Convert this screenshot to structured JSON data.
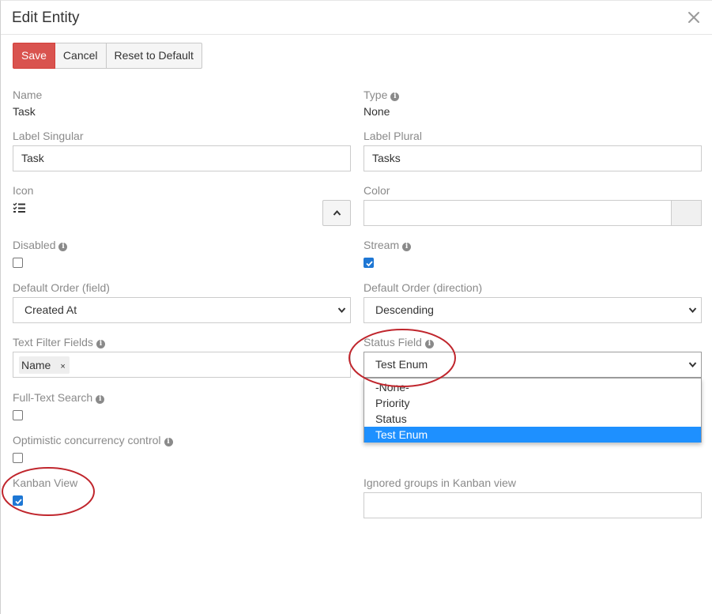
{
  "header": {
    "title": "Edit Entity",
    "close_icon": "close-icon"
  },
  "toolbar": {
    "save_label": "Save",
    "cancel_label": "Cancel",
    "reset_label": "Reset to Default"
  },
  "colors": {
    "save_bg": "#d9534f",
    "checkbox_checked": "#1e77d4",
    "selected_option": "#1e90ff",
    "annotation": "#c0262d"
  },
  "fields": {
    "name": {
      "label": "Name",
      "value": "Task"
    },
    "type": {
      "label": "Type",
      "value": "None"
    },
    "label_singular": {
      "label": "Label Singular",
      "value": "Task"
    },
    "label_plural": {
      "label": "Label Plural",
      "value": "Tasks"
    },
    "icon": {
      "label": "Icon",
      "icon_name": "tasks-checklist-icon"
    },
    "color": {
      "label": "Color",
      "value": ""
    },
    "disabled": {
      "label": "Disabled",
      "checked": false
    },
    "stream": {
      "label": "Stream",
      "checked": true
    },
    "default_order_field": {
      "label": "Default Order (field)",
      "value": "Created At"
    },
    "default_order_direction": {
      "label": "Default Order (direction)",
      "value": "Descending"
    },
    "text_filter_fields": {
      "label": "Text Filter Fields",
      "tags": [
        "Name"
      ],
      "tag_remove": "×"
    },
    "status_field": {
      "label": "Status Field",
      "value": "Test Enum",
      "options": [
        "-None-",
        "Priority",
        "Status",
        "Test Enum"
      ],
      "selected_index": 3
    },
    "full_text_search": {
      "label": "Full-Text Search",
      "checked": false
    },
    "optimistic_concurrency": {
      "label": "Optimistic concurrency control",
      "checked": false
    },
    "kanban_view": {
      "label": "Kanban View",
      "checked": true
    },
    "ignored_groups": {
      "label": "Ignored groups in Kanban view",
      "value": ""
    }
  }
}
